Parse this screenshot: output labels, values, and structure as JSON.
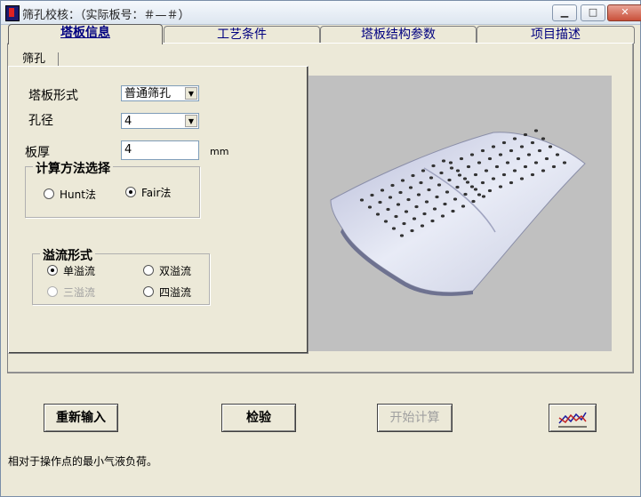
{
  "window": {
    "title": "筛孔校核：（实际板号：＃—＃）",
    "controls": [
      "minimize",
      "maximize",
      "close"
    ]
  },
  "tabs": [
    "塔板信息",
    "工艺条件",
    "塔板结构参数",
    "项目描述"
  ],
  "active_tab": "塔板信息",
  "subtab": "筛孔",
  "form": {
    "tray_type": {
      "label": "塔板形式",
      "value": "普通筛孔"
    },
    "hole_diameter": {
      "label": "孔径",
      "value": "4"
    },
    "plate_thickness": {
      "label": "板厚",
      "value": "4",
      "unit": "mm"
    }
  },
  "calc_method": {
    "title": "计算方法选择",
    "options": [
      {
        "label": "Hunt法",
        "checked": false,
        "enabled": true
      },
      {
        "label": "Fair法",
        "checked": true,
        "enabled": true
      }
    ]
  },
  "overflow": {
    "title": "溢流形式",
    "options": [
      {
        "label": "单溢流",
        "checked": true,
        "enabled": true
      },
      {
        "label": "双溢流",
        "checked": false,
        "enabled": true
      },
      {
        "label": "三溢流",
        "checked": false,
        "enabled": false
      },
      {
        "label": "四溢流",
        "checked": false,
        "enabled": true
      }
    ]
  },
  "buttons": {
    "reset": "重新输入",
    "check": "检验",
    "start": "开始计算",
    "chart": "chart-icon"
  },
  "status": "相对于操作点的最小气液负荷。"
}
